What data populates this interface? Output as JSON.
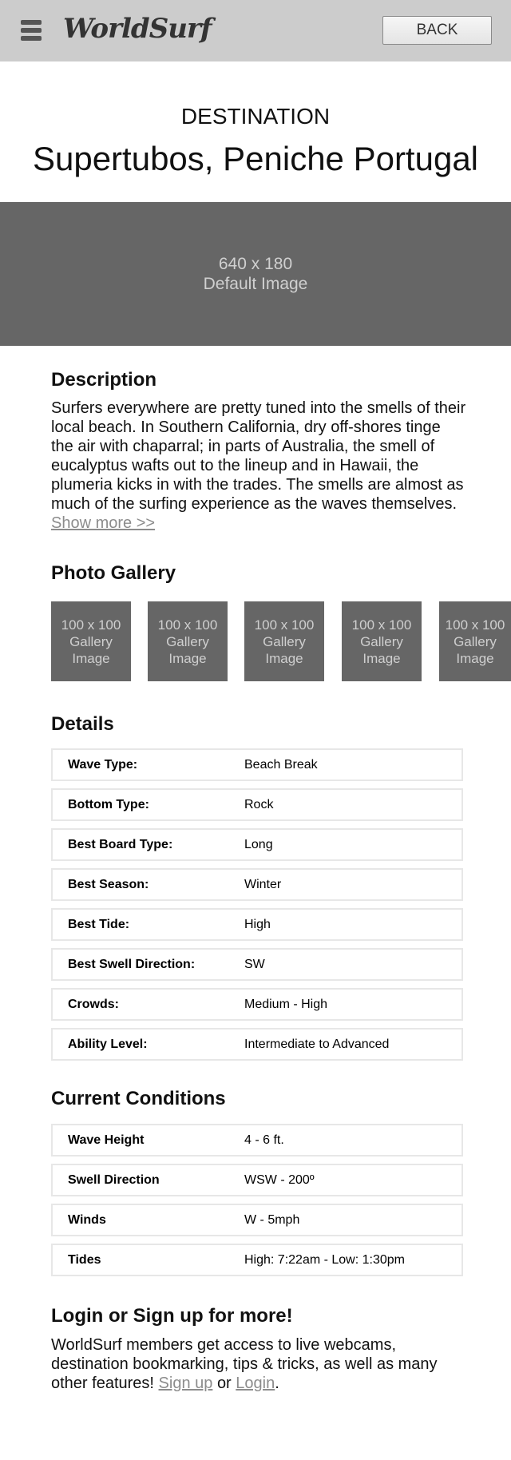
{
  "header": {
    "logo": "WorldSurf",
    "back_label": "BACK"
  },
  "title": {
    "eyebrow": "DESTINATION",
    "name": "Supertubos, Peniche Portugal"
  },
  "hero": {
    "line1": "640 x 180",
    "line2": "Default Image"
  },
  "description": {
    "heading": "Description",
    "text": "Surfers everywhere are pretty tuned into the smells of their local beach. In Southern California, dry off-shores tinge the air with chaparral; in parts of Australia, the smell of eucalyptus wafts out to the lineup and in Hawaii, the plumeria kicks in with the trades. The smells are almost as much of the surfing experience as the waves themselves.",
    "show_more": "Show more >>"
  },
  "gallery": {
    "heading": "Photo Gallery",
    "items": [
      {
        "line1": "100 x 100",
        "line2": "Gallery",
        "line3": "Image"
      },
      {
        "line1": "100 x 100",
        "line2": "Gallery",
        "line3": "Image"
      },
      {
        "line1": "100 x 100",
        "line2": "Gallery",
        "line3": "Image"
      },
      {
        "line1": "100 x 100",
        "line2": "Gallery",
        "line3": "Image"
      },
      {
        "line1": "100 x 100",
        "line2": "Gallery",
        "line3": "Image"
      }
    ]
  },
  "details": {
    "heading": "Details",
    "rows": [
      {
        "label": "Wave Type:",
        "value": "Beach Break"
      },
      {
        "label": "Bottom Type:",
        "value": "Rock"
      },
      {
        "label": "Best Board Type:",
        "value": "Long"
      },
      {
        "label": "Best Season:",
        "value": "Winter"
      },
      {
        "label": "Best Tide:",
        "value": "High"
      },
      {
        "label": "Best Swell Direction:",
        "value": "SW"
      },
      {
        "label": "Crowds:",
        "value": "Medium - High"
      },
      {
        "label": "Ability Level:",
        "value": "Intermediate to Advanced"
      }
    ]
  },
  "conditions": {
    "heading": "Current Conditions",
    "rows": [
      {
        "label": "Wave Height",
        "value": "4 - 6 ft."
      },
      {
        "label": "Swell Direction",
        "value": "WSW - 200º"
      },
      {
        "label": "Winds",
        "value": "W - 5mph"
      },
      {
        "label": "Tides",
        "value": "High: 7:22am -  Low: 1:30pm"
      }
    ]
  },
  "login": {
    "heading": "Login or Sign up for more!",
    "text": "WorldSurf members get access to live webcams, destination bookmarking, tips & tricks, as well as many other features!",
    "signup_label": "Sign up",
    "or": "or",
    "login_label": "Login",
    "period": "."
  }
}
